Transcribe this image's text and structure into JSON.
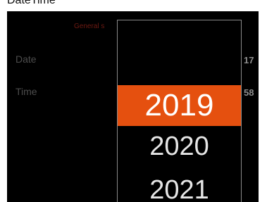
{
  "header": {
    "top_text": "DateTime"
  },
  "settings": {
    "section_label": "General s",
    "rows": [
      {
        "label": "Date",
        "value": "17"
      },
      {
        "label": "Time",
        "value": "58"
      }
    ]
  },
  "year_picker": {
    "selected": "2019",
    "items_below": [
      "2020",
      "2021"
    ],
    "accent_color": "#e5500f"
  }
}
